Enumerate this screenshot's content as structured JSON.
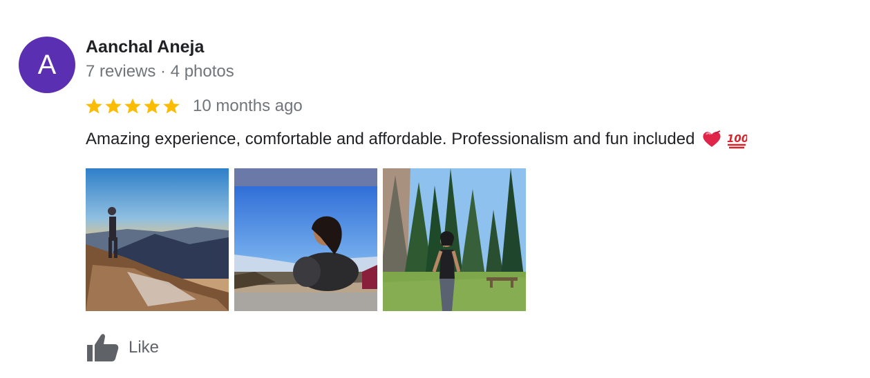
{
  "review": {
    "author": {
      "initial": "A",
      "name": "Aanchal Aneja",
      "meta": "7 reviews · 4 photos",
      "avatar_color": "#5b2fb2"
    },
    "rating": {
      "stars": 5,
      "max": 5,
      "star_color": "#fbbc04",
      "date": "10 months ago"
    },
    "text": "Amazing experience, comfortable and affordable. Professionalism and fun included",
    "emojis": [
      "heart-icon",
      "hundred-points-icon"
    ],
    "photos": [
      {
        "name": "mountain-sunset-photo"
      },
      {
        "name": "reclining-person-photo"
      },
      {
        "name": "forest-walk-photo"
      }
    ],
    "actions": {
      "like_label": "Like"
    }
  }
}
